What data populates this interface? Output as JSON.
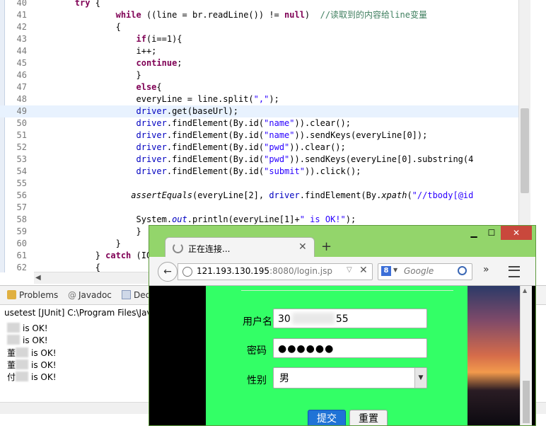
{
  "editor": {
    "lines": [
      {
        "n": "40",
        "segs": [
          [
            "t",
            "        "
          ],
          [
            "kw",
            "try"
          ],
          [
            "t",
            " {"
          ]
        ]
      },
      {
        "n": "41",
        "segs": [
          [
            "t",
            "                "
          ],
          [
            "kw",
            "while"
          ],
          [
            "t",
            " ((line = br.readLine()) != "
          ],
          [
            "kw",
            "null"
          ],
          [
            "t",
            ")  "
          ],
          [
            "cmt",
            "//读取到的内容给line变量"
          ]
        ]
      },
      {
        "n": "42",
        "segs": [
          [
            "t",
            "                {"
          ]
        ]
      },
      {
        "n": "43",
        "segs": [
          [
            "t",
            "                    "
          ],
          [
            "kw",
            "if"
          ],
          [
            "t",
            "(i==1){"
          ]
        ]
      },
      {
        "n": "44",
        "segs": [
          [
            "t",
            "                    i++;"
          ]
        ]
      },
      {
        "n": "45",
        "segs": [
          [
            "t",
            "                    "
          ],
          [
            "kw",
            "continue"
          ],
          [
            "t",
            ";"
          ]
        ]
      },
      {
        "n": "46",
        "segs": [
          [
            "t",
            "                    }"
          ]
        ]
      },
      {
        "n": "47",
        "segs": [
          [
            "t",
            "                    "
          ],
          [
            "kw",
            "else"
          ],
          [
            "t",
            "{"
          ]
        ]
      },
      {
        "n": "48",
        "segs": [
          [
            "t",
            "                    everyLine = line.split("
          ],
          [
            "str",
            "\",\""
          ],
          [
            "t",
            ");"
          ]
        ]
      },
      {
        "n": "49",
        "segs": [
          [
            "t",
            "                    "
          ],
          [
            "fld",
            "driver"
          ],
          [
            "t",
            ".get(baseUrl);"
          ]
        ]
      },
      {
        "n": "50",
        "segs": [
          [
            "t",
            "                    "
          ],
          [
            "fld",
            "driver"
          ],
          [
            "t",
            ".findElement(By.id("
          ],
          [
            "str",
            "\"name\""
          ],
          [
            "t",
            ")).clear();"
          ]
        ]
      },
      {
        "n": "51",
        "segs": [
          [
            "t",
            "                    "
          ],
          [
            "fld",
            "driver"
          ],
          [
            "t",
            ".findElement(By.id("
          ],
          [
            "str",
            "\"name\""
          ],
          [
            "t",
            ")).sendKeys(everyLine[0]);"
          ]
        ]
      },
      {
        "n": "52",
        "segs": [
          [
            "t",
            "                    "
          ],
          [
            "fld",
            "driver"
          ],
          [
            "t",
            ".findElement(By.id("
          ],
          [
            "str",
            "\"pwd\""
          ],
          [
            "t",
            ")).clear();"
          ]
        ]
      },
      {
        "n": "53",
        "segs": [
          [
            "t",
            "                    "
          ],
          [
            "fld",
            "driver"
          ],
          [
            "t",
            ".findElement(By.id("
          ],
          [
            "str",
            "\"pwd\""
          ],
          [
            "t",
            ")).sendKeys(everyLine[0].substring(4"
          ]
        ]
      },
      {
        "n": "54",
        "segs": [
          [
            "t",
            "                    "
          ],
          [
            "fld",
            "driver"
          ],
          [
            "t",
            ".findElement(By.id("
          ],
          [
            "str",
            "\"submit\""
          ],
          [
            "t",
            ")).click();"
          ]
        ]
      },
      {
        "n": "55",
        "segs": [
          [
            "t",
            ""
          ]
        ]
      },
      {
        "n": "56",
        "segs": [
          [
            "t",
            "                   "
          ],
          [
            "it",
            "assertEquals"
          ],
          [
            "t",
            "(everyLine[2], "
          ],
          [
            "fld",
            "driver"
          ],
          [
            "t",
            ".findElement(By."
          ],
          [
            "it",
            "xpath"
          ],
          [
            "t",
            "("
          ],
          [
            "str",
            "\"//tbody[@id"
          ]
        ]
      },
      {
        "n": "57",
        "segs": [
          [
            "t",
            ""
          ]
        ]
      },
      {
        "n": "58",
        "segs": [
          [
            "t",
            "                    System."
          ],
          [
            "itf",
            "out"
          ],
          [
            "t",
            ".println(everyLine[1]+"
          ],
          [
            "str",
            "\" is OK!\""
          ],
          [
            "t",
            ");"
          ]
        ]
      },
      {
        "n": "59",
        "segs": [
          [
            "t",
            "                    }"
          ]
        ]
      },
      {
        "n": "60",
        "segs": [
          [
            "t",
            "                }"
          ]
        ]
      },
      {
        "n": "61",
        "segs": [
          [
            "t",
            "            } "
          ],
          [
            "kw",
            "catch"
          ],
          [
            "t",
            " (IOEx"
          ]
        ]
      },
      {
        "n": "62",
        "segs": [
          [
            "t",
            "            {"
          ]
        ]
      }
    ]
  },
  "panel": {
    "tabs": [
      {
        "label": "Problems",
        "icon": "problems-icon"
      },
      {
        "label": "Javadoc",
        "icon": "javadoc-icon"
      },
      {
        "label": "Dec",
        "icon": "declaration-icon"
      }
    ],
    "console_title": "usetest [JUnit] C:\\Program Files\\Jav",
    "console_lines": [
      {
        "prefix": "",
        "text": "is OK!"
      },
      {
        "prefix": "",
        "text": "is OK!"
      },
      {
        "prefix": "董",
        "text": "is OK!"
      },
      {
        "prefix": "董",
        "text": "is OK!"
      },
      {
        "prefix": "付",
        "text": "is OK!"
      }
    ]
  },
  "browser": {
    "tab_title": "正在连接...",
    "url_host": "121.193.130.195",
    "url_rest": ":8080/login.jsp",
    "search_placeholder": "Google",
    "search_engine_letter": "8",
    "form": {
      "username_label": "用户名",
      "username_value_start": "30",
      "username_value_end": "55",
      "password_label": "密码",
      "password_value": "●●●●●●",
      "gender_label": "性别",
      "gender_value": "男",
      "submit_label": "提交",
      "reset_label": "重置"
    }
  }
}
